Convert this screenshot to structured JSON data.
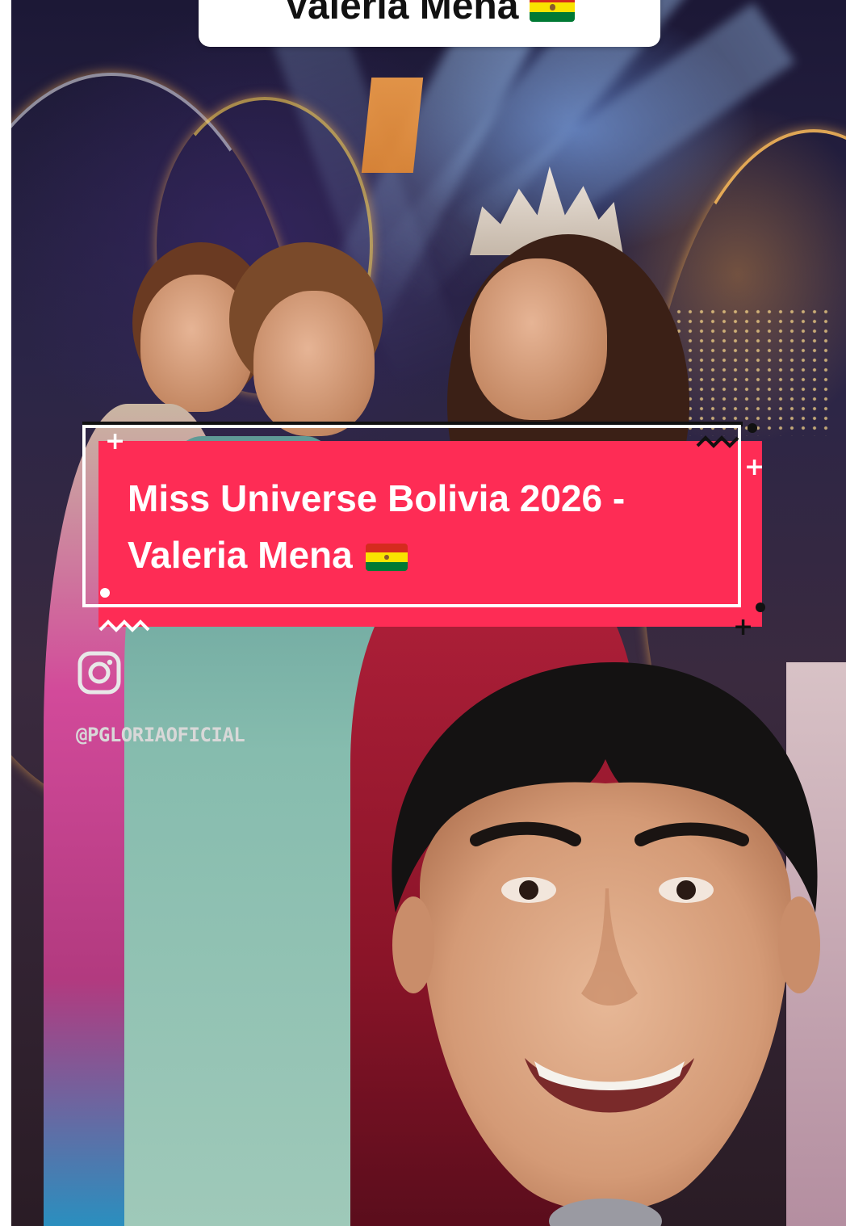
{
  "top_caption": {
    "text": "Valeria Mena",
    "flag_icon": "bolivia-flag-icon"
  },
  "title_card": {
    "line1": "Miss Universe Bolivia 2026 -",
    "line2": "Valeria Mena",
    "flag_icon": "bolivia-flag-icon",
    "background_color": "#fe2c55"
  },
  "watermark": {
    "icon": "instagram-icon",
    "handle": "@PGLORIAOFICIAL"
  }
}
